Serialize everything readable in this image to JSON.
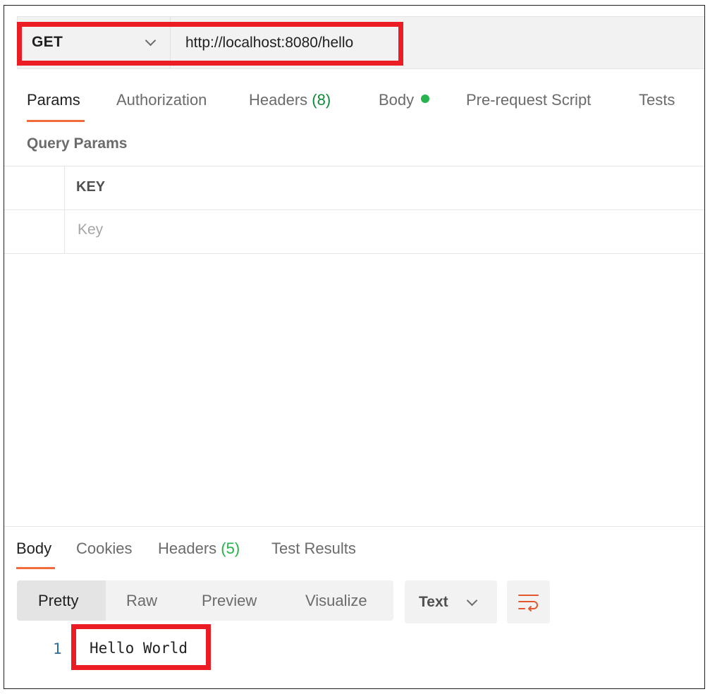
{
  "request": {
    "method": "GET",
    "url": "http://localhost:8080/hello"
  },
  "request_tabs": {
    "params": "Params",
    "authorization": "Authorization",
    "headers": "Headers",
    "headers_count": "(8)",
    "body": "Body",
    "prerequest": "Pre-request Script",
    "tests": "Tests"
  },
  "query_params": {
    "title": "Query Params",
    "key_header": "KEY",
    "key_placeholder": "Key"
  },
  "response_tabs": {
    "body": "Body",
    "cookies": "Cookies",
    "headers": "Headers",
    "headers_count": "(5)",
    "test_results": "Test Results"
  },
  "view_modes": {
    "pretty": "Pretty",
    "raw": "Raw",
    "preview": "Preview",
    "visualize": "Visualize"
  },
  "format": {
    "selected": "Text"
  },
  "response_body": {
    "line_number": "1",
    "line_text": "Hello World"
  },
  "colors": {
    "highlight": "#ec1c24",
    "active_tab_underline": "#f26b3a",
    "body_indicator": "#26b34b",
    "headers_count": "#0f8a3b"
  },
  "icons": {
    "method_dropdown": "chevron-down-icon",
    "format_dropdown": "chevron-down-icon",
    "wrap": "word-wrap-icon",
    "body_indicator": "status-dot-icon"
  }
}
